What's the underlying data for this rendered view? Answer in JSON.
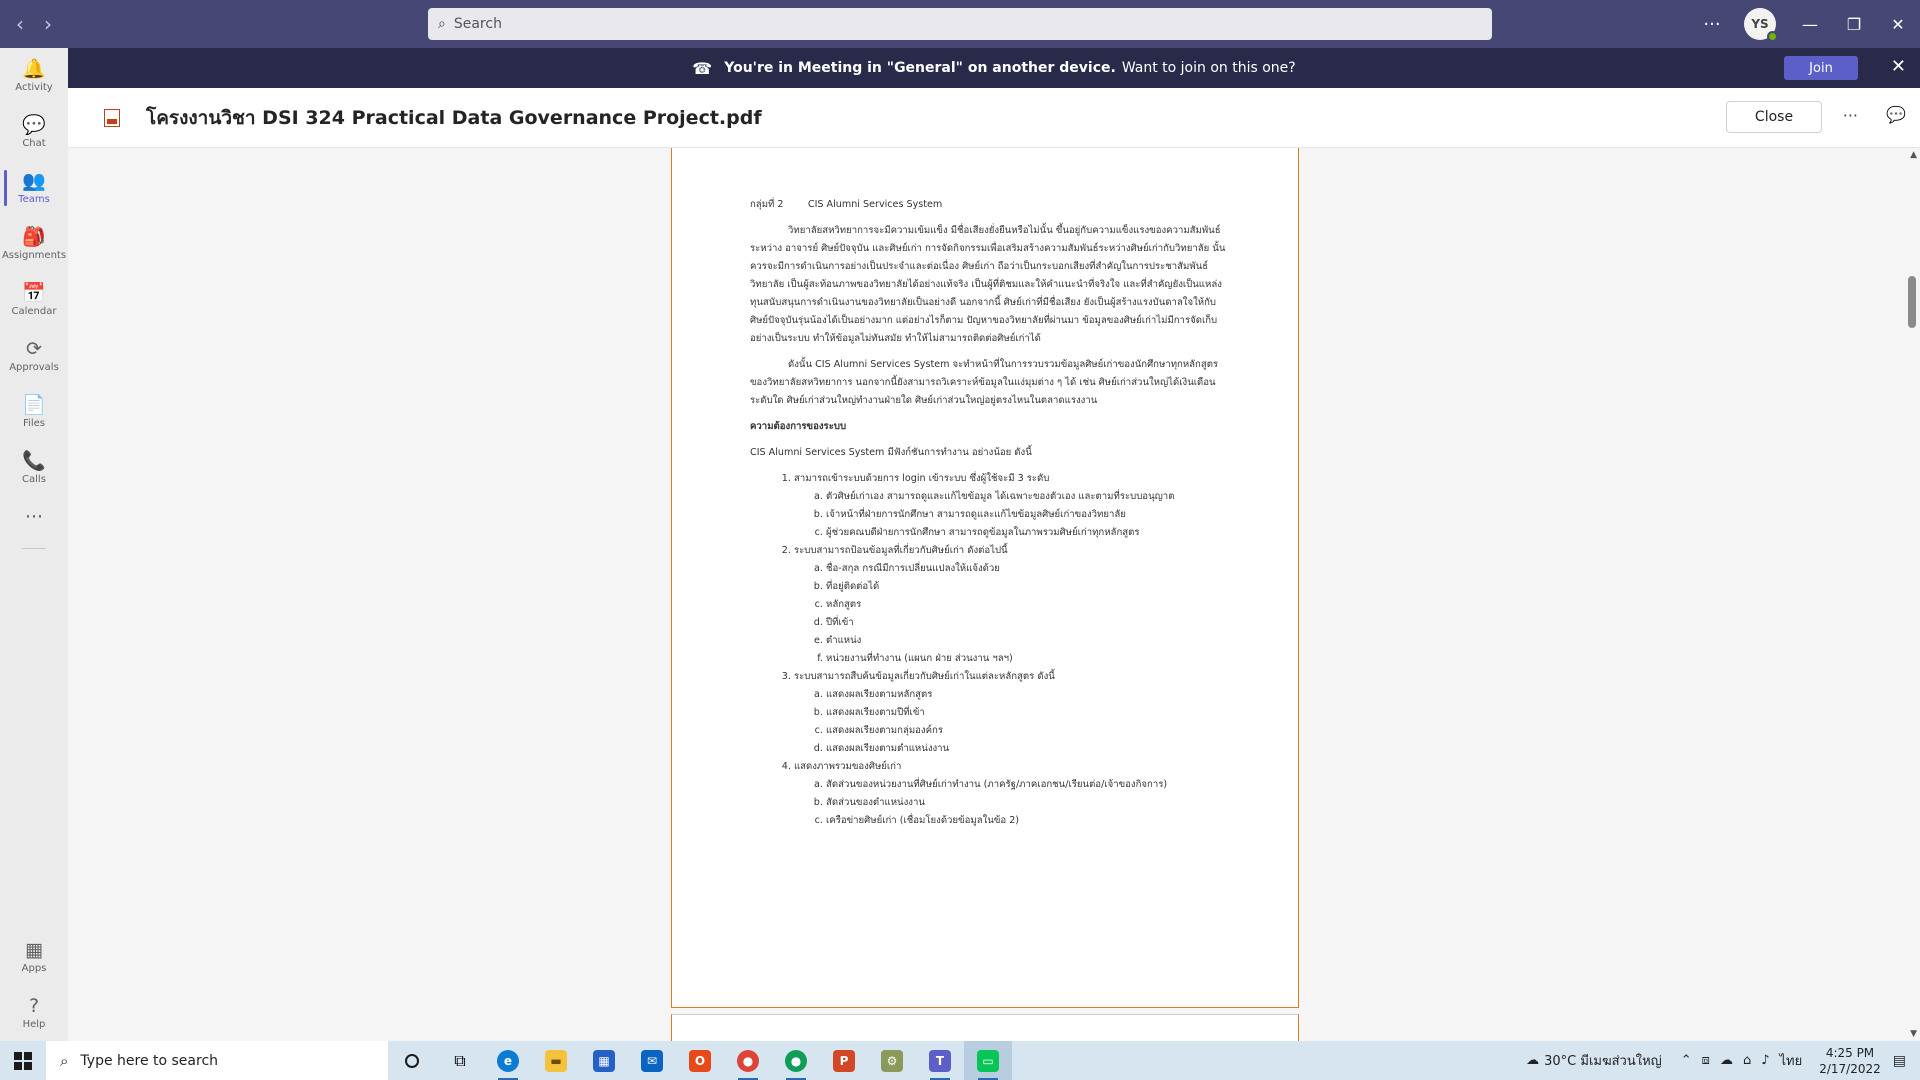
{
  "titlebar": {
    "search_placeholder": "Search",
    "more_label": "···",
    "avatar_initials": "YS",
    "minimize": "—",
    "restore": "❐",
    "close": "✕"
  },
  "rail": {
    "items": [
      {
        "label": "Activity",
        "icon": "bell-icon",
        "glyph": "🔔"
      },
      {
        "label": "Chat",
        "icon": "chat-icon",
        "glyph": "💬"
      },
      {
        "label": "Teams",
        "icon": "teams-icon",
        "glyph": "👥"
      },
      {
        "label": "Assignments",
        "icon": "assignments-icon",
        "glyph": "🎒"
      },
      {
        "label": "Calendar",
        "icon": "calendar-icon",
        "glyph": "📅"
      },
      {
        "label": "Approvals",
        "icon": "approvals-icon",
        "glyph": "⟳"
      },
      {
        "label": "Files",
        "icon": "files-icon",
        "glyph": "📄"
      },
      {
        "label": "Calls",
        "icon": "phone-icon",
        "glyph": "📞"
      }
    ],
    "more": "···",
    "apps": "Apps",
    "help": "Help"
  },
  "banner": {
    "bold_text": "You're in Meeting in \"General\" on another device.",
    "text": "Want to join on this one?",
    "join_label": "Join",
    "close": "✕"
  },
  "document": {
    "title": "โครงงานวิชา DSI 324 Practical Data Governance Project.pdf",
    "close_label": "Close",
    "more": "···",
    "chat": "💬"
  },
  "pdf": {
    "group_line": "กลุ่มที่ 2        CIS Alumni Services System",
    "para1": "วิทยาลัยสหวิทยาการจะมีความเข้มแข็ง มีชื่อเสียงยั่งยืนหรือไม่นั้น ขึ้นอยู่กับความแข็งแรงของความสัมพันธ์ระหว่าง อาจารย์ ศิษย์ปัจจุบัน และศิษย์เก่า การจัดกิจกรรมเพื่อเสริมสร้างความสัมพันธ์ระหว่างศิษย์เก่ากับวิทยาลัย นั้นควรจะมีการดำเนินการอย่างเป็นประจำและต่อเนื่อง ศิษย์เก่า ถือว่าเป็นกระบอกเสียงที่สำคัญในการประชาสัมพันธ์วิทยาลัย เป็นผู้สะท้อนภาพของวิทยาลัยได้อย่างแท้จริง เป็นผู้ที่ติชมและให้คำแนะนำที่จริงใจ และที่สำคัญยังเป็นแหล่งทุนสนับสนุนการดำเนินงานของวิทยาลัยเป็นอย่างดี นอกจากนี้ ศิษย์เก่าที่มีชื่อเสียง ยังเป็นผู้สร้างแรงบันดาลใจให้กับศิษย์ปัจจุบันรุ่นน้องได้เป็นอย่างมาก แต่อย่างไรก็ตาม ปัญหาของวิทยาลัยที่ผ่านมา ข้อมูลของศิษย์เก่าไม่มีการจัดเก็บอย่างเป็นระบบ ทำให้ข้อมูลไม่ทันสมัย ทำให้ไม่สามารถติดต่อศิษย์เก่าได้",
    "para2": "ดังนั้น CIS Alumni Services System จะทำหน้าที่ในการรวบรวมข้อมูลศิษย์เก่าของนักศึกษาทุกหลักสูตรของวิทยาลัยสหวิทยาการ นอกจากนี้ยังสามารถวิเคราะห์ข้อมูลในแง่มุมต่าง ๆ ได้ เช่น ศิษย์เก่าส่วนใหญ่ได้เงินเดือนระดับใด ศิษย์เก่าส่วนใหญ่ทำงานฝ่ายใด ศิษย์เก่าส่วนใหญ่อยู่ตรงไหนในตลาดแรงงาน",
    "req_header": "ความต้องการของระบบ",
    "req_intro": "CIS Alumni Services System มีฟังก์ชันการทำงาน อย่างน้อย ดังนี้",
    "items": [
      {
        "text": "สามารถเข้าระบบด้วยการ login เข้าระบบ ซึ่งผู้ใช้จะมี 3 ระดับ",
        "sub": [
          "ตัวศิษย์เก่าเอง สามารถดูและแก้ไขข้อมูล ได้เฉพาะของตัวเอง และตามที่ระบบอนุญาต",
          "เจ้าหน้าที่ฝ่ายการนักศึกษา สามารถดูและแก้ไขข้อมูลศิษย์เก่าของวิทยาลัย",
          "ผู้ช่วยคณบดีฝ่ายการนักศึกษา สามารถดูข้อมูลในภาพรวมศิษย์เก่าทุกหลักสูตร"
        ]
      },
      {
        "text": "ระบบสามารถป้อนข้อมูลที่เกี่ยวกับศิษย์เก่า ดังต่อไปนี้",
        "sub": [
          "ชื่อ-สกุล กรณีมีการเปลี่ยนแปลงให้แจ้งด้วย",
          "ที่อยู่ติดต่อได้",
          "หลักสูตร",
          "ปีที่เข้า",
          "ตำแหน่ง",
          "หน่วยงานที่ทำงาน (แผนก ฝ่าย ส่วนงาน ฯลฯ)"
        ]
      },
      {
        "text": "ระบบสามารถสืบค้นข้อมูลเกี่ยวกับศิษย์เก่าในแต่ละหลักสูตร ดังนี้",
        "sub": [
          "แสดงผลเรียงตามหลักสูตร",
          "แสดงผลเรียงตามปีที่เข้า",
          "แสดงผลเรียงตามกลุ่มองค์กร",
          "แสดงผลเรียงตามตำแหน่งงาน"
        ]
      },
      {
        "text": "แสดงภาพรวมของศิษย์เก่า",
        "sub": [
          "สัดส่วนของหน่วยงานที่ศิษย์เก่าทำงาน (ภาครัฐ/ภาคเอกชน/เรียนต่อ/เจ้าของกิจการ)",
          "สัดส่วนของตำแหน่งงาน",
          "เครือข่ายศิษย์เก่า (เชื่อมโยงด้วยข้อมูลในข้อ 2)"
        ]
      }
    ]
  },
  "taskbar": {
    "search_placeholder": "Type here to search",
    "weather": "30°C  มีเมฆส่วนใหญ่",
    "lang": "ไทย",
    "time": "4:25 PM",
    "date": "2/17/2022"
  },
  "colors": {
    "titlebar": "#464775",
    "banner": "#292a4a",
    "accent": "#5b5fc7",
    "page_border": "#e07b20"
  }
}
